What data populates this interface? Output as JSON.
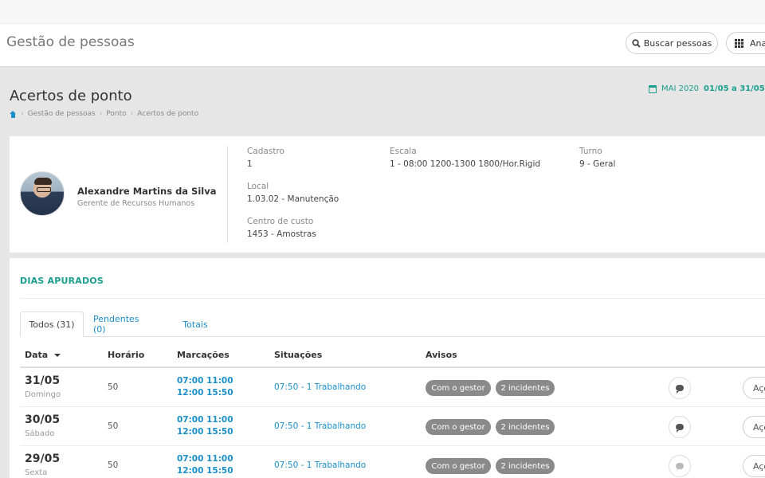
{
  "app": {
    "title": "Gestão de pessoas",
    "search_button": "Buscar pessoas",
    "apps_button": "Ana"
  },
  "page": {
    "title": "Acertos de ponto",
    "breadcrumb": [
      "Gestão de pessoas",
      "Ponto",
      "Acertos de ponto"
    ],
    "period_month": "MAI 2020",
    "period_range": "01/05 a 31/05"
  },
  "profile": {
    "name": "Alexandre Martins da Silva",
    "role": "Gerente de Recursos Humanos",
    "fields": {
      "cadastro_label": "Cadastro",
      "cadastro_value": "1",
      "escala_label": "Escala",
      "escala_value": "1 - 08:00 1200-1300 1800/Hor.Rigid",
      "turno_label": "Turno",
      "turno_value": "9 - Geral",
      "local_label": "Local",
      "local_value": "1.03.02 - Manutenção",
      "centro_label": "Centro de custo",
      "centro_value": "1453 - Amostras"
    }
  },
  "section": {
    "title": "DIAS APURADOS",
    "tabs": [
      "Todos (31)",
      "Pendentes (0)",
      "Totais"
    ],
    "columns": [
      "Data",
      "Horário",
      "Marcações",
      "Situações",
      "Avisos"
    ]
  },
  "rows": [
    {
      "date": "31/05",
      "day": "Domingo",
      "horario": "50",
      "marcacoes": "07:00 11:00 12:00 15:50",
      "situacao": "07:50 - 1 Trabalhando",
      "badge1": "Com o gestor",
      "badge2": "2 incidentes",
      "acoes": "Açõ"
    },
    {
      "date": "30/05",
      "day": "Sábado",
      "horario": "50",
      "marcacoes": "07:00 11:00 12:00 15:50",
      "situacao": "07:50 - 1 Trabalhando",
      "badge1": "Com o gestor",
      "badge2": "2 incidentes",
      "acoes": "Açõ"
    },
    {
      "date": "29/05",
      "day": "Sexta",
      "horario": "50",
      "marcacoes": "07:00 11:00 12:00 15:50",
      "situacao": "07:50 - 1 Trabalhando",
      "badge1": "Com o gestor",
      "badge2": "2 incidentes",
      "acoes": "Açõ"
    }
  ],
  "colors": {
    "accent_teal": "#1a9e8e",
    "link_blue": "#1a8fc9",
    "badge_gray": "#8a8a8a"
  },
  "icons": [
    "search-icon",
    "apps-grid-icon",
    "home-icon",
    "calendar-icon",
    "sort-caret-icon",
    "chat-icon"
  ]
}
